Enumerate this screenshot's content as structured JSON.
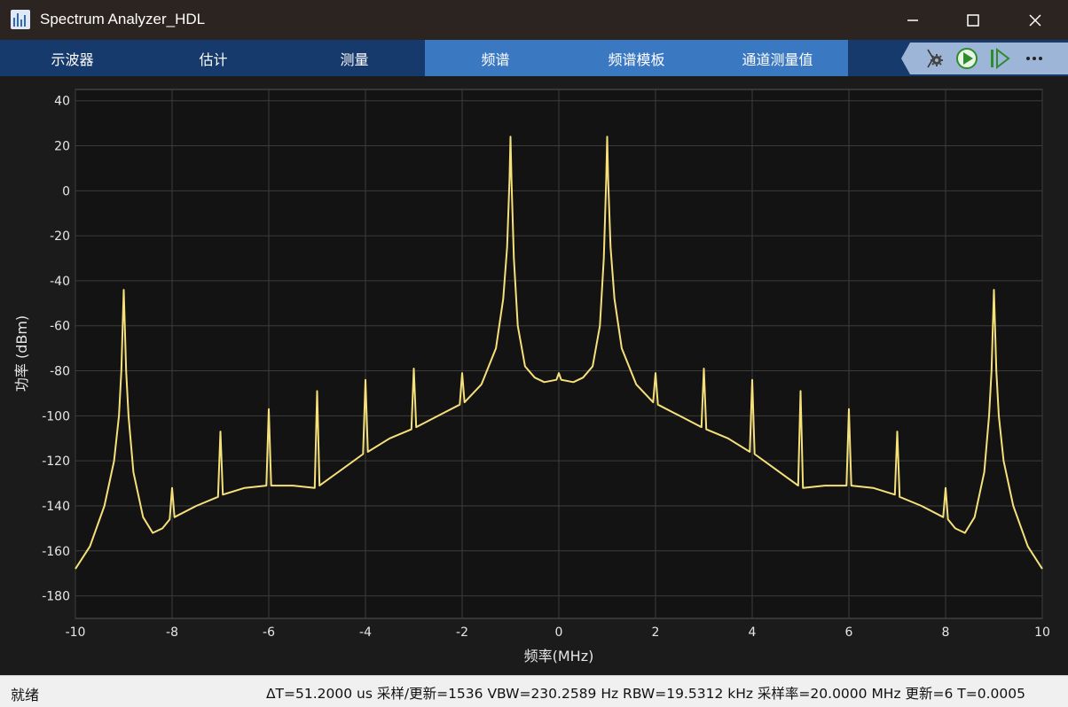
{
  "window": {
    "title": "Spectrum Analyzer_HDL",
    "icon": "spectrum-analyzer-icon"
  },
  "tabs": [
    {
      "label": "示波器",
      "active": false
    },
    {
      "label": "估计",
      "active": false
    },
    {
      "label": "测量",
      "active": false
    },
    {
      "label": "频谱",
      "active": true
    },
    {
      "label": "频谱模板",
      "active": false
    },
    {
      "label": "通道测量值",
      "active": false
    }
  ],
  "toolbar": {
    "icons": [
      "settings-gear-icon",
      "run-icon",
      "step-forward-icon",
      "more-icon"
    ]
  },
  "colors": {
    "trace": "#f6e07a",
    "plot_bg": "#131313",
    "grid": "#3c3c3c",
    "tab_active": "#3a78c2",
    "tab_bar": "#173a6d"
  },
  "status": {
    "left": "就绪",
    "right": "ΔT=51.2000 us  采样/更新=1536  VBW=230.2589 Hz  RBW=19.5312 kHz  采样率=20.0000 MHz  更新=6  T=0.0005"
  },
  "chart_data": {
    "type": "line",
    "xlabel": "频率(MHz)",
    "ylabel": "功率 (dBm)",
    "xlim": [
      -10,
      10
    ],
    "ylim": [
      -190,
      45
    ],
    "xticks": [
      -10,
      -8,
      -6,
      -4,
      -2,
      0,
      2,
      4,
      6,
      8,
      10
    ],
    "yticks": [
      40,
      20,
      0,
      -20,
      -40,
      -60,
      -80,
      -100,
      -120,
      -140,
      -160,
      -180
    ],
    "grid": true,
    "series": [
      {
        "x": [
          -10,
          -9.7,
          -9.4,
          -9.2,
          -9.1,
          -9.05,
          -9,
          -8.95,
          -8.9,
          -8.8,
          -8.6,
          -8.4,
          -8.2,
          -8.05,
          -8,
          -7.95,
          -7.5,
          -7.05,
          -7,
          -6.95,
          -6.5,
          -6.05,
          -6,
          -5.95,
          -5.5,
          -5.05,
          -5,
          -4.95,
          -4.5,
          -4.05,
          -4,
          -3.95,
          -3.5,
          -3.05,
          -3,
          -2.95,
          -2.5,
          -2.05,
          -2,
          -1.95,
          -1.6,
          -1.3,
          -1.15,
          -1.07,
          -1.02,
          -1,
          -0.98,
          -0.93,
          -0.85,
          -0.7,
          -0.5,
          -0.3,
          -0.05,
          0,
          0.05,
          0.3,
          0.5,
          0.7,
          0.85,
          0.93,
          0.98,
          1,
          1.02,
          1.07,
          1.15,
          1.3,
          1.6,
          1.95,
          2,
          2.05,
          2.5,
          2.95,
          3,
          3.05,
          3.5,
          3.95,
          4,
          4.05,
          4.5,
          4.95,
          5,
          5.05,
          5.5,
          5.95,
          6,
          6.05,
          6.5,
          6.95,
          7,
          7.05,
          7.5,
          7.95,
          8,
          8.05,
          8.2,
          8.4,
          8.6,
          8.8,
          8.9,
          8.95,
          9,
          9.05,
          9.1,
          9.2,
          9.4,
          9.7,
          10
        ],
        "y": [
          -168,
          -158,
          -140,
          -120,
          -100,
          -80,
          -44,
          -80,
          -100,
          -125,
          -145,
          -152,
          -150,
          -146,
          -132,
          -145,
          -140,
          -136,
          -107,
          -135,
          -132,
          -131,
          -97,
          -131,
          -131,
          -132,
          -89,
          -131,
          -124,
          -117,
          -84,
          -116,
          -110,
          -106,
          -79,
          -105,
          -100,
          -95,
          -81,
          -94,
          -86,
          -70,
          -48,
          -25,
          5,
          24,
          5,
          -30,
          -60,
          -78,
          -83,
          -85,
          -84,
          -81,
          -84,
          -85,
          -83,
          -78,
          -60,
          -30,
          5,
          24,
          5,
          -25,
          -48,
          -70,
          -86,
          -94,
          -81,
          -95,
          -100,
          -105,
          -79,
          -106,
          -110,
          -116,
          -84,
          -117,
          -124,
          -131,
          -89,
          -132,
          -131,
          -131,
          -97,
          -131,
          -132,
          -135,
          -107,
          -136,
          -140,
          -145,
          -132,
          -146,
          -150,
          -152,
          -145,
          -125,
          -100,
          -80,
          -44,
          -80,
          -100,
          -120,
          -140,
          -158,
          -168
        ]
      }
    ]
  }
}
